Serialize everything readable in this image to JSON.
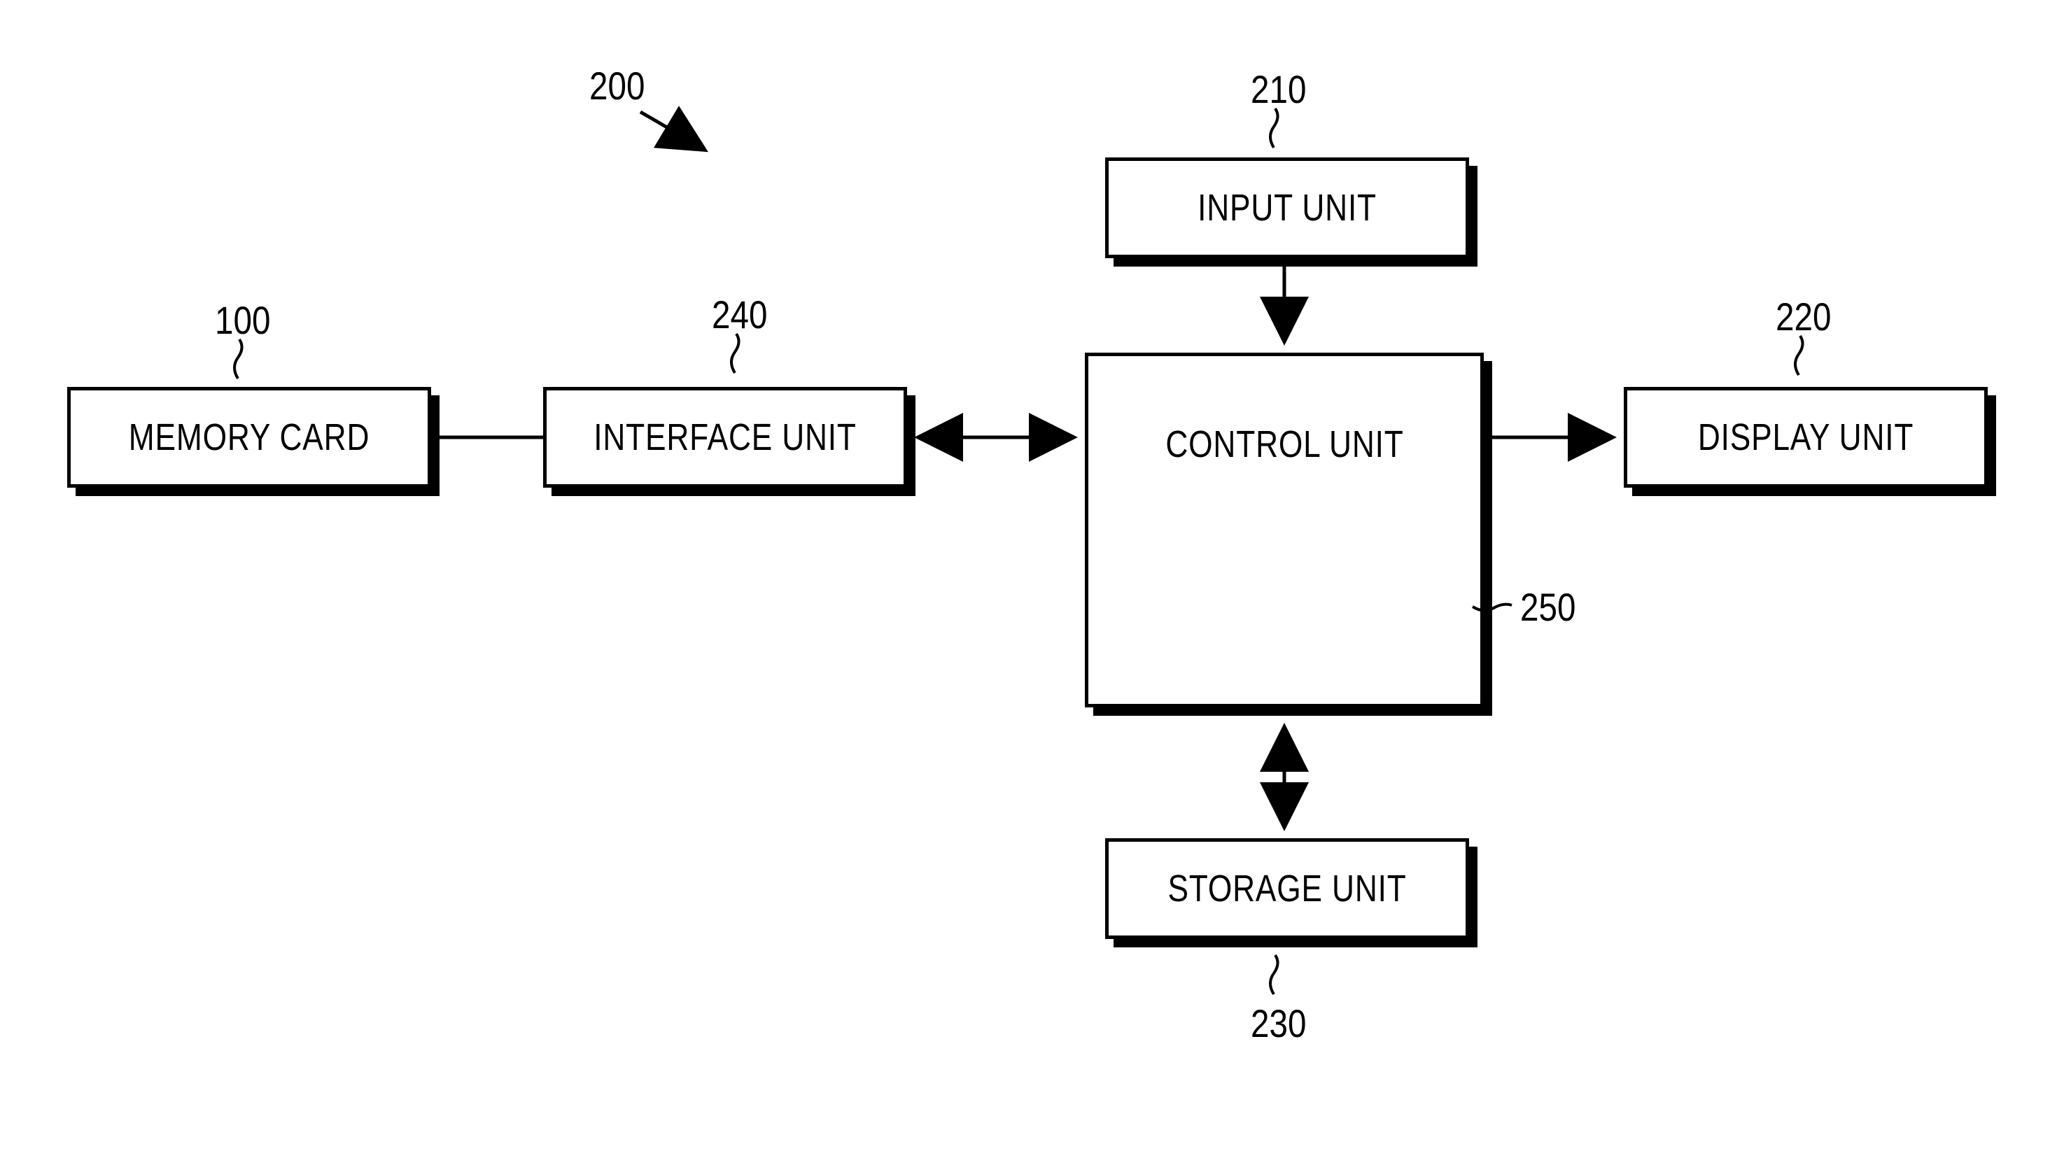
{
  "refs": {
    "memory_card": "100",
    "system": "200",
    "input_unit": "210",
    "display_unit": "220",
    "storage_unit": "230",
    "interface_unit": "240",
    "control_unit": "250"
  },
  "blocks": {
    "memory_card": "MEMORY CARD",
    "interface_unit": "INTERFACE UNIT",
    "input_unit": "INPUT UNIT",
    "control_unit": "CONTROL UNIT",
    "display_unit": "DISPLAY UNIT",
    "storage_unit": "STORAGE UNIT"
  }
}
